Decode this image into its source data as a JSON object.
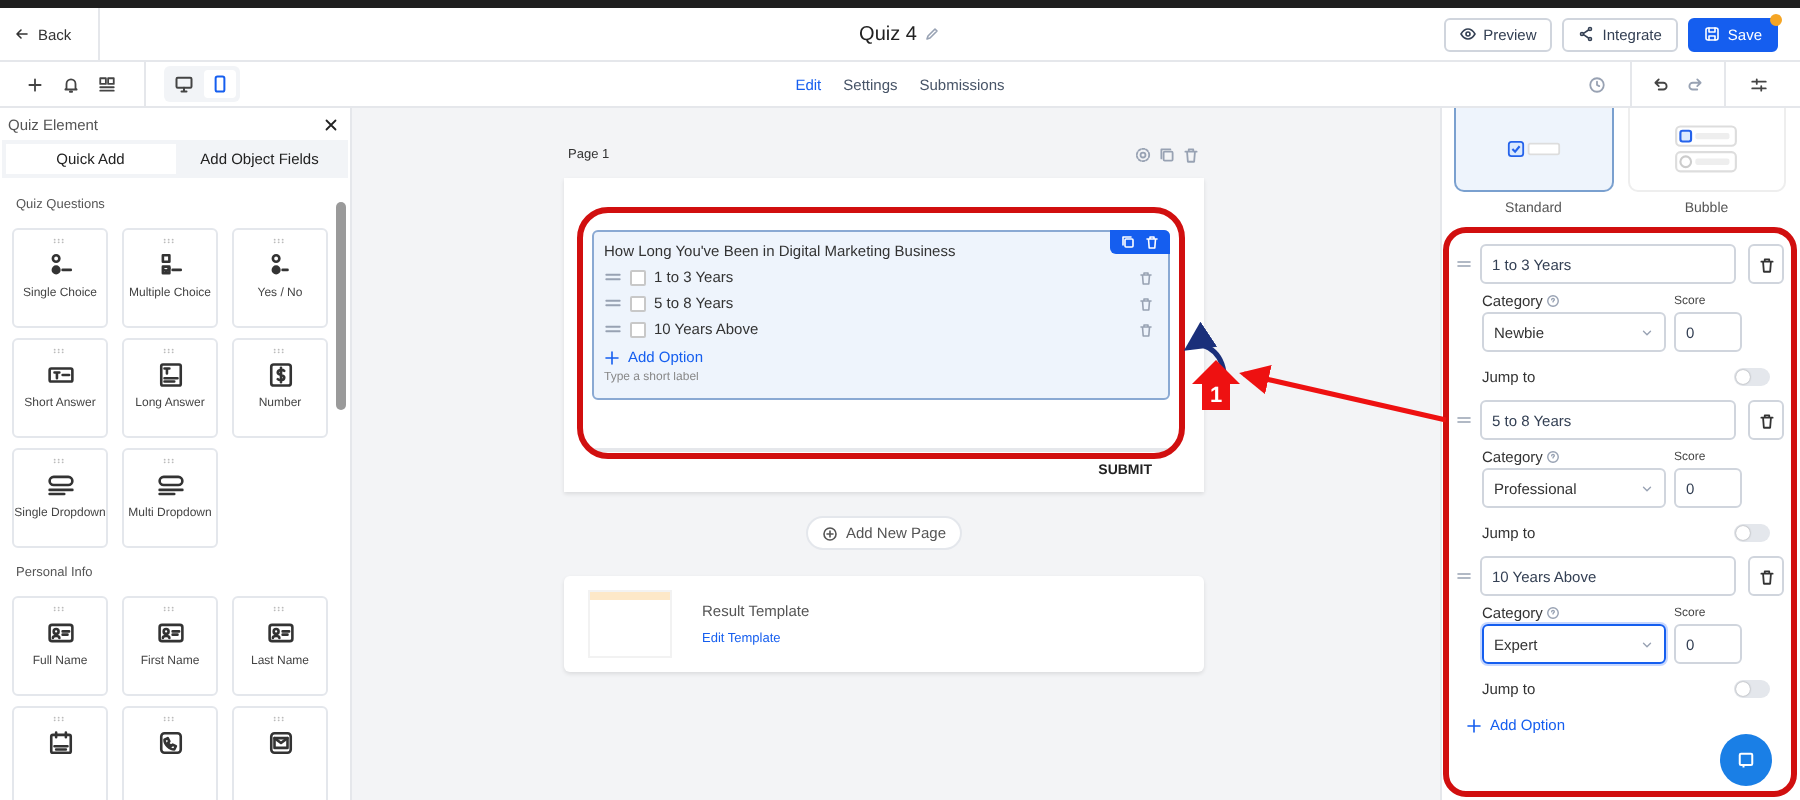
{
  "header": {
    "back": "Back",
    "title": "Quiz 4",
    "buttons": [
      {
        "label": "Preview",
        "kind": "preview"
      },
      {
        "label": "Integrate",
        "kind": "integrate"
      },
      {
        "label": "Save",
        "kind": "save"
      }
    ]
  },
  "toolbar": {
    "view_modes": [
      {
        "kind": "desktop",
        "selected": false
      },
      {
        "kind": "mobile",
        "selected": true
      }
    ],
    "tabs": [
      {
        "label": "Edit",
        "selected": true
      },
      {
        "label": "Settings",
        "selected": false
      },
      {
        "label": "Submissions",
        "selected": false
      }
    ]
  },
  "left_panel": {
    "title": "Quiz Element",
    "tabs": [
      {
        "label": "Quick Add",
        "selected": true
      },
      {
        "label": "Add Object Fields",
        "selected": false
      }
    ],
    "sections": [
      {
        "title": "Quiz Questions",
        "items": [
          {
            "label": "Single Choice",
            "kind": "single"
          },
          {
            "label": "Multiple Choice",
            "kind": "multiple"
          },
          {
            "label": "Yes / No",
            "kind": "yesno"
          },
          {
            "label": "Short Answer",
            "kind": "short"
          },
          {
            "label": "Long Answer",
            "kind": "long"
          },
          {
            "label": "Number",
            "kind": "number"
          },
          {
            "label": "Single Dropdown",
            "kind": "dropdown"
          },
          {
            "label": "Multi Dropdown",
            "kind": "dropdown"
          }
        ]
      },
      {
        "title": "Personal Info",
        "items": [
          {
            "label": "Full Name",
            "kind": "name"
          },
          {
            "label": "First Name",
            "kind": "name"
          },
          {
            "label": "Last Name",
            "kind": "name"
          },
          {
            "kind": "date"
          },
          {
            "kind": "phone"
          },
          {
            "kind": "email"
          }
        ]
      }
    ]
  },
  "canvas": {
    "page_label": "Page 1",
    "question": {
      "title": "How Long You've Been in Digital Marketing Business",
      "options": [
        {
          "label": "1 to 3 Years",
          "checked": false
        },
        {
          "label": "5 to 8 Years",
          "checked": false
        },
        {
          "label": "10 Years Above",
          "checked": false
        }
      ],
      "add_option": "Add Option",
      "label_placeholder": "Type a short label"
    },
    "submit": "SUBMIT",
    "add_page": "Add New Page",
    "result": {
      "title": "Result Template",
      "link": "Edit Template"
    }
  },
  "right_panel": {
    "styles": [
      {
        "label": "Standard",
        "selected": true
      },
      {
        "label": "Bubble",
        "selected": false
      }
    ],
    "options": [
      {
        "value": "1 to 3 Years",
        "category_label": "Category",
        "category": "Newbie",
        "focused": false,
        "score_label": "Score",
        "score": "0",
        "jump_label": "Jump to",
        "jump": false
      },
      {
        "value": "5 to 8 Years",
        "category_label": "Category",
        "category": "Professional",
        "focused": false,
        "score_label": "Score",
        "score": "0",
        "jump_label": "Jump to",
        "jump": false
      },
      {
        "value": "10 Years Above",
        "category_label": "Category",
        "category": "Expert",
        "focused": true,
        "score_label": "Score",
        "score": "0",
        "jump_label": "Jump to",
        "jump": false
      }
    ],
    "add_option": "Add Option"
  },
  "annotation": {
    "step": "1"
  }
}
